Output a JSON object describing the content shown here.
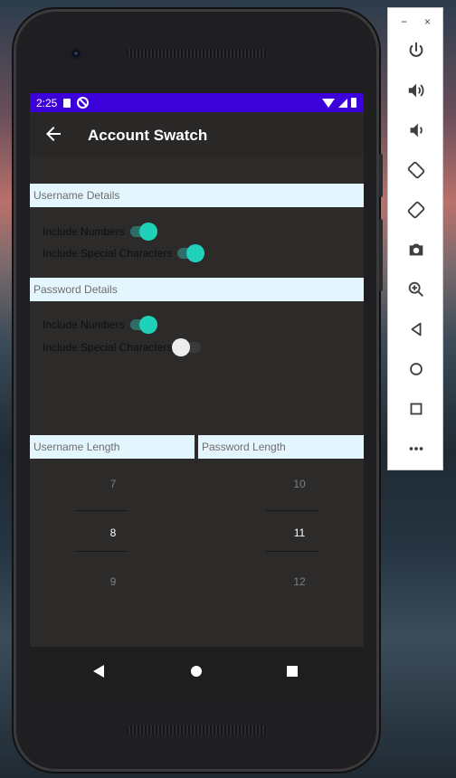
{
  "status_bar": {
    "time": "2:25"
  },
  "app_bar": {
    "title": "Account Swatch"
  },
  "username_details": {
    "header": "Username Details",
    "include_numbers": {
      "label": "Include Numbers",
      "on": true
    },
    "include_special": {
      "label": "Include Special Characters",
      "on": true
    }
  },
  "password_details": {
    "header": "Password Details",
    "include_numbers": {
      "label": "Include Numbers",
      "on": true
    },
    "include_special": {
      "label": "Include Special Characters",
      "on": false
    }
  },
  "username_length": {
    "header": "Username Length",
    "prev": "7",
    "selected": "8",
    "next": "9"
  },
  "password_length": {
    "header": "Password Length",
    "prev": "10",
    "selected": "11",
    "next": "12"
  },
  "toolbar": {
    "minimize_label": "−",
    "close_label": "×",
    "buttons": [
      "power-icon",
      "volume-up-icon",
      "volume-down-icon",
      "rotate-left-icon",
      "rotate-right-icon",
      "camera-icon",
      "zoom-icon",
      "back-icon",
      "home-icon",
      "overview-icon",
      "more-icon"
    ]
  },
  "colors": {
    "accent": "#1fd1b9",
    "status_bar": "#3c00d8",
    "header_bg": "#e3f6fd"
  }
}
